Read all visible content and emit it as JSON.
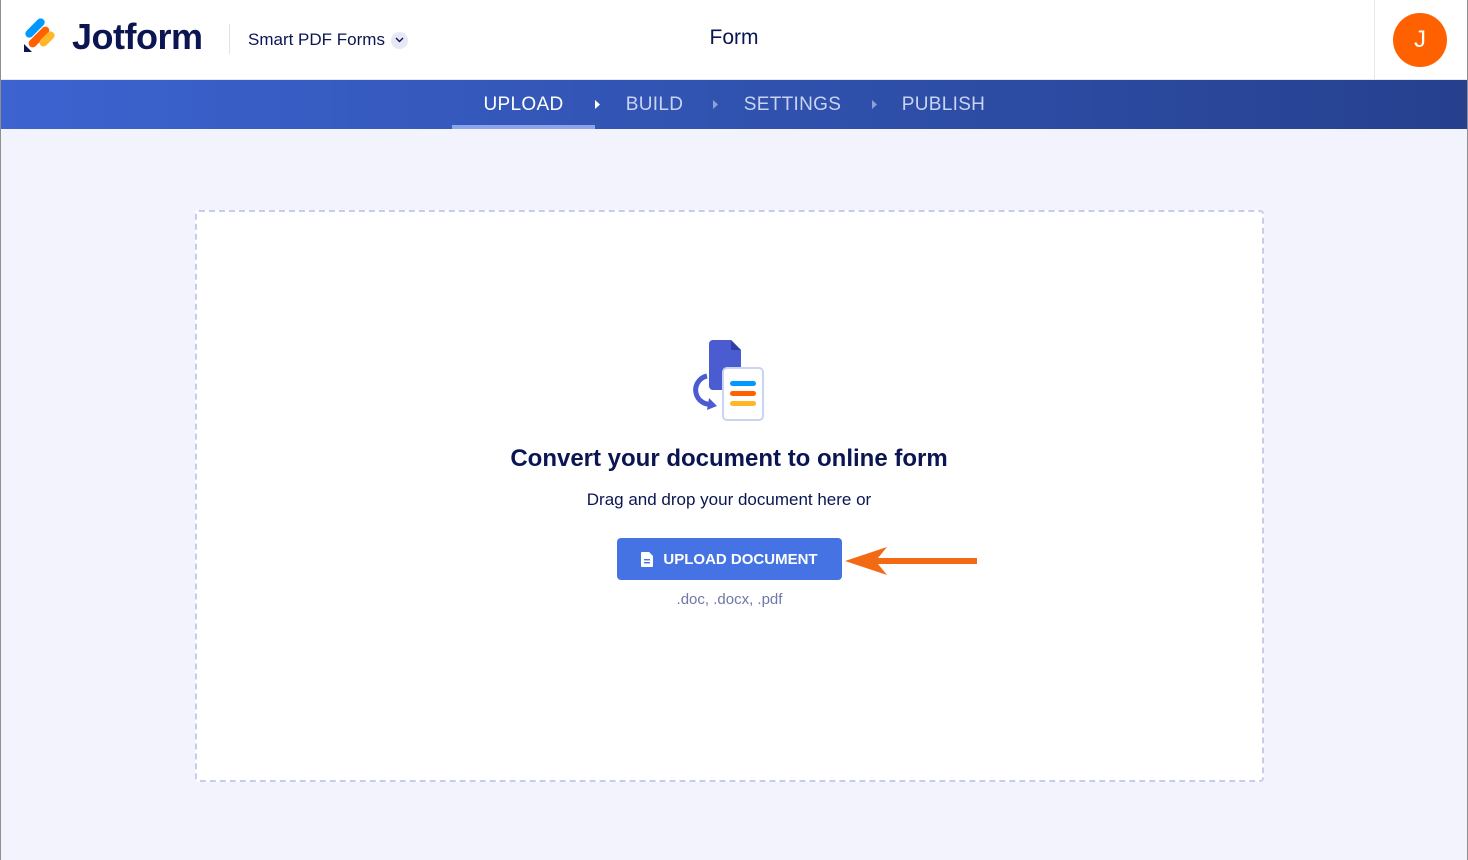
{
  "header": {
    "brand": "Jotform",
    "product_switch": "Smart PDF Forms",
    "title": "Form",
    "avatar_initial": "J",
    "avatar_color": "#ff6100"
  },
  "nav": {
    "active": "UPLOAD",
    "steps": [
      {
        "label": "UPLOAD"
      },
      {
        "label": "BUILD"
      },
      {
        "label": "SETTINGS"
      },
      {
        "label": "PUBLISH"
      }
    ]
  },
  "main": {
    "headline": "Convert your document to online form",
    "subline": "Drag and drop your document here or",
    "upload_button": "UPLOAD DOCUMENT",
    "formats": ".doc, .docx, .pdf"
  },
  "icons": [
    "jotform-logo-icon",
    "chevron-down-icon",
    "nav-arrow-icon",
    "document-convert-icon",
    "file-icon",
    "annotation-arrow-icon"
  ],
  "colors": {
    "brand_navy": "#0a1551",
    "nav_blue": "#3c63d0",
    "button_blue": "#4573e3",
    "annotation_arrow": "#f26b14"
  }
}
